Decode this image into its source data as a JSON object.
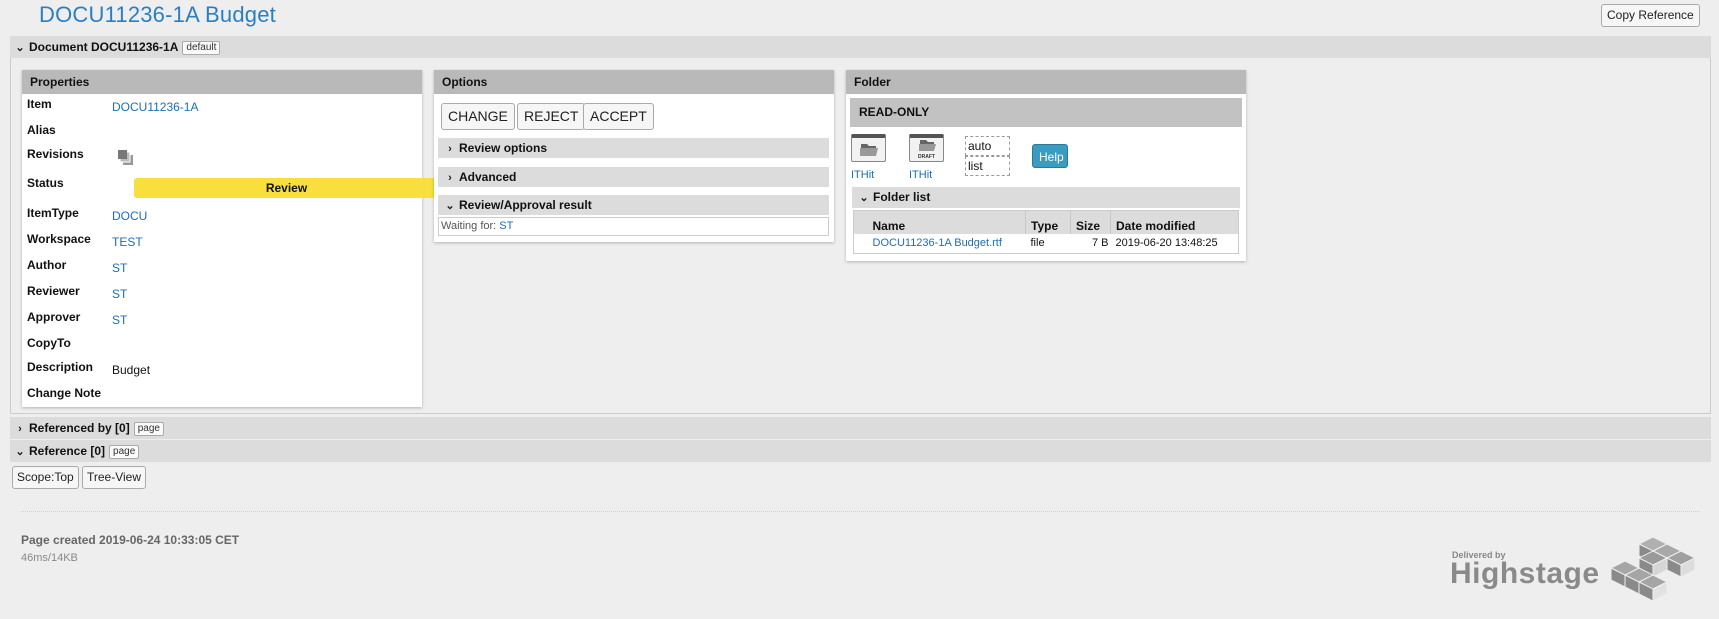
{
  "page": {
    "title": "DOCU11236-1A Budget",
    "copy_reference_label": "Copy Reference"
  },
  "document_section": {
    "label": "Document DOCU11236-1A",
    "tag": "default",
    "expanded": true
  },
  "properties": {
    "title": "Properties",
    "rows": {
      "item": {
        "label": "Item",
        "value": "DOCU11236-1A"
      },
      "alias": {
        "label": "Alias",
        "value": ""
      },
      "revisions": {
        "label": "Revisions",
        "icon": "revisions-icon"
      },
      "status": {
        "label": "Status",
        "value": "Review",
        "color": "#f8df3d"
      },
      "itemtype": {
        "label": "ItemType",
        "value": "DOCU"
      },
      "workspace": {
        "label": "Workspace",
        "value": "TEST"
      },
      "author": {
        "label": "Author",
        "value": "ST"
      },
      "reviewer": {
        "label": "Reviewer",
        "value": "ST"
      },
      "approver": {
        "label": "Approver",
        "value": "ST"
      },
      "copyto": {
        "label": "CopyTo",
        "value": ""
      },
      "description": {
        "label": "Description",
        "value": "Budget"
      },
      "change_note": {
        "label": "Change Note",
        "value": ""
      }
    }
  },
  "options": {
    "title": "Options",
    "buttons": {
      "change": "CHANGE",
      "reject": "REJECT",
      "accept": "ACCEPT"
    },
    "sections": {
      "review_options": {
        "label": "Review options",
        "expanded": false
      },
      "advanced": {
        "label": "Advanced",
        "expanded": false
      },
      "review_result": {
        "label": "Review/Approval result",
        "expanded": true
      }
    },
    "waiting_for_label": "Waiting for:",
    "waiting_for_value": "ST"
  },
  "folder": {
    "title": "Folder",
    "mode": "READ-ONLY",
    "open_folder_label": "ITHit",
    "open_draft_label": "ITHit",
    "draft_badge": "DRAFT",
    "view_options": {
      "auto": "auto",
      "list": "list"
    },
    "help_label": "Help",
    "help_color": "#3a9cc0",
    "list_section_label": "Folder list",
    "columns": [
      "Name",
      "Type",
      "Size",
      "Date modified"
    ],
    "files": [
      {
        "name": "DOCU11236-1A Budget.rtf",
        "type": "file",
        "size": "7 B",
        "modified": "2019-06-20 13:48:25"
      }
    ]
  },
  "referenced_by": {
    "label": "Referenced by [0]",
    "tag": "page",
    "expanded": false
  },
  "reference": {
    "label": "Reference [0]",
    "tag": "page",
    "expanded": true,
    "scope_button": "Scope:Top",
    "tree_view_button": "Tree-View"
  },
  "footer": {
    "created": "Page created 2019-06-24 10:33:05 CET",
    "stats": "46ms/14KB",
    "brand_small": "Delivered by",
    "brand_big": "Highstage"
  }
}
